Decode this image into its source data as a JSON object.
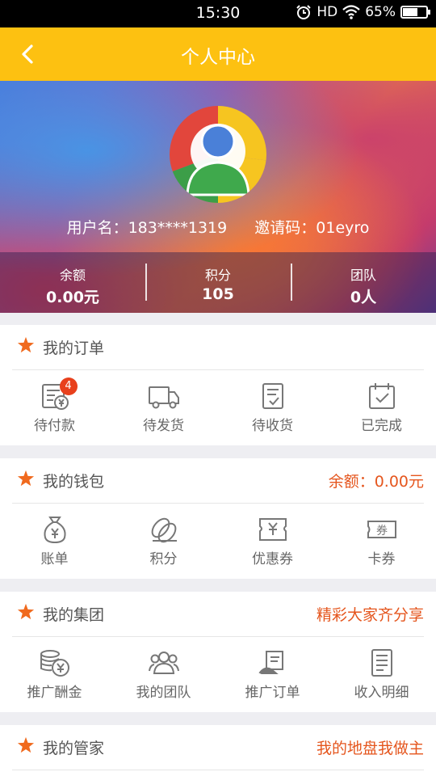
{
  "status_bar": {
    "time": "15:30",
    "network": "HD",
    "battery_text": "65%",
    "battery_level": 0.65
  },
  "nav": {
    "title": "个人中心",
    "back_icon": "chevron-left-icon"
  },
  "profile": {
    "username_label": "用户名：183****1319",
    "invite_label": "邀请码：01eyro",
    "stats": [
      {
        "label": "余额",
        "value": "0.00元"
      },
      {
        "label": "积分",
        "value": "105"
      },
      {
        "label": "团队",
        "value": "0人"
      }
    ]
  },
  "orders": {
    "title": "我的订单",
    "items": [
      {
        "label": "待付款",
        "icon": "payment-icon",
        "badge": "4"
      },
      {
        "label": "待发货",
        "icon": "truck-icon"
      },
      {
        "label": "待收货",
        "icon": "receive-icon"
      },
      {
        "label": "已完成",
        "icon": "calendar-check-icon"
      }
    ]
  },
  "wallet": {
    "title": "我的钱包",
    "extra": "余额：0.00元",
    "items": [
      {
        "label": "账单",
        "icon": "money-bag-icon"
      },
      {
        "label": "积分",
        "icon": "coins-icon"
      },
      {
        "label": "优惠券",
        "icon": "coupon-icon"
      },
      {
        "label": "卡券",
        "icon": "card-ticket-icon",
        "icon_text": "券"
      }
    ]
  },
  "group": {
    "title": "我的集团",
    "extra": "精彩大家齐分享",
    "items": [
      {
        "label": "推广酬金",
        "icon": "coin-stack-icon"
      },
      {
        "label": "我的团队",
        "icon": "team-icon"
      },
      {
        "label": "推广订单",
        "icon": "promo-order-icon"
      },
      {
        "label": "收入明细",
        "icon": "income-detail-icon"
      }
    ]
  },
  "steward": {
    "title": "我的管家",
    "extra": "我的地盘我做主"
  },
  "colors": {
    "brand": "#fdc111",
    "accent": "#e5561e",
    "star": "#f06a1e",
    "badge": "#e8401c"
  }
}
